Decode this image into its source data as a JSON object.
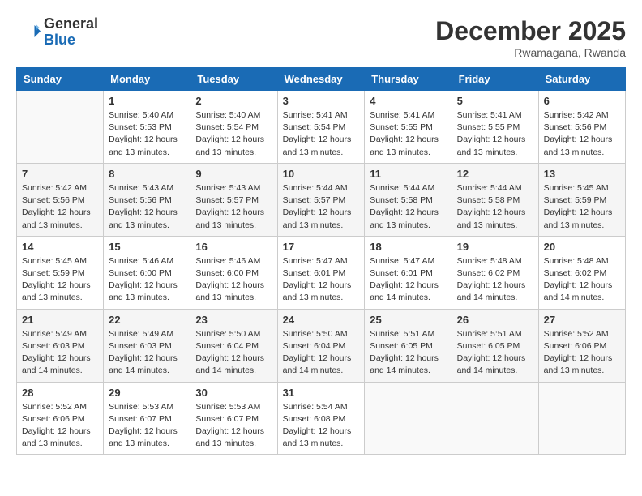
{
  "logo": {
    "general": "General",
    "blue": "Blue"
  },
  "header": {
    "month": "December 2025",
    "location": "Rwamagana, Rwanda"
  },
  "weekdays": [
    "Sunday",
    "Monday",
    "Tuesday",
    "Wednesday",
    "Thursday",
    "Friday",
    "Saturday"
  ],
  "weeks": [
    [
      {
        "day": "",
        "sunrise": "",
        "sunset": "",
        "daylight": ""
      },
      {
        "day": "1",
        "sunrise": "Sunrise: 5:40 AM",
        "sunset": "Sunset: 5:53 PM",
        "daylight": "Daylight: 12 hours and 13 minutes."
      },
      {
        "day": "2",
        "sunrise": "Sunrise: 5:40 AM",
        "sunset": "Sunset: 5:54 PM",
        "daylight": "Daylight: 12 hours and 13 minutes."
      },
      {
        "day": "3",
        "sunrise": "Sunrise: 5:41 AM",
        "sunset": "Sunset: 5:54 PM",
        "daylight": "Daylight: 12 hours and 13 minutes."
      },
      {
        "day": "4",
        "sunrise": "Sunrise: 5:41 AM",
        "sunset": "Sunset: 5:55 PM",
        "daylight": "Daylight: 12 hours and 13 minutes."
      },
      {
        "day": "5",
        "sunrise": "Sunrise: 5:41 AM",
        "sunset": "Sunset: 5:55 PM",
        "daylight": "Daylight: 12 hours and 13 minutes."
      },
      {
        "day": "6",
        "sunrise": "Sunrise: 5:42 AM",
        "sunset": "Sunset: 5:56 PM",
        "daylight": "Daylight: 12 hours and 13 minutes."
      }
    ],
    [
      {
        "day": "7",
        "sunrise": "Sunrise: 5:42 AM",
        "sunset": "Sunset: 5:56 PM",
        "daylight": "Daylight: 12 hours and 13 minutes."
      },
      {
        "day": "8",
        "sunrise": "Sunrise: 5:43 AM",
        "sunset": "Sunset: 5:56 PM",
        "daylight": "Daylight: 12 hours and 13 minutes."
      },
      {
        "day": "9",
        "sunrise": "Sunrise: 5:43 AM",
        "sunset": "Sunset: 5:57 PM",
        "daylight": "Daylight: 12 hours and 13 minutes."
      },
      {
        "day": "10",
        "sunrise": "Sunrise: 5:44 AM",
        "sunset": "Sunset: 5:57 PM",
        "daylight": "Daylight: 12 hours and 13 minutes."
      },
      {
        "day": "11",
        "sunrise": "Sunrise: 5:44 AM",
        "sunset": "Sunset: 5:58 PM",
        "daylight": "Daylight: 12 hours and 13 minutes."
      },
      {
        "day": "12",
        "sunrise": "Sunrise: 5:44 AM",
        "sunset": "Sunset: 5:58 PM",
        "daylight": "Daylight: 12 hours and 13 minutes."
      },
      {
        "day": "13",
        "sunrise": "Sunrise: 5:45 AM",
        "sunset": "Sunset: 5:59 PM",
        "daylight": "Daylight: 12 hours and 13 minutes."
      }
    ],
    [
      {
        "day": "14",
        "sunrise": "Sunrise: 5:45 AM",
        "sunset": "Sunset: 5:59 PM",
        "daylight": "Daylight: 12 hours and 13 minutes."
      },
      {
        "day": "15",
        "sunrise": "Sunrise: 5:46 AM",
        "sunset": "Sunset: 6:00 PM",
        "daylight": "Daylight: 12 hours and 13 minutes."
      },
      {
        "day": "16",
        "sunrise": "Sunrise: 5:46 AM",
        "sunset": "Sunset: 6:00 PM",
        "daylight": "Daylight: 12 hours and 13 minutes."
      },
      {
        "day": "17",
        "sunrise": "Sunrise: 5:47 AM",
        "sunset": "Sunset: 6:01 PM",
        "daylight": "Daylight: 12 hours and 13 minutes."
      },
      {
        "day": "18",
        "sunrise": "Sunrise: 5:47 AM",
        "sunset": "Sunset: 6:01 PM",
        "daylight": "Daylight: 12 hours and 14 minutes."
      },
      {
        "day": "19",
        "sunrise": "Sunrise: 5:48 AM",
        "sunset": "Sunset: 6:02 PM",
        "daylight": "Daylight: 12 hours and 14 minutes."
      },
      {
        "day": "20",
        "sunrise": "Sunrise: 5:48 AM",
        "sunset": "Sunset: 6:02 PM",
        "daylight": "Daylight: 12 hours and 14 minutes."
      }
    ],
    [
      {
        "day": "21",
        "sunrise": "Sunrise: 5:49 AM",
        "sunset": "Sunset: 6:03 PM",
        "daylight": "Daylight: 12 hours and 14 minutes."
      },
      {
        "day": "22",
        "sunrise": "Sunrise: 5:49 AM",
        "sunset": "Sunset: 6:03 PM",
        "daylight": "Daylight: 12 hours and 14 minutes."
      },
      {
        "day": "23",
        "sunrise": "Sunrise: 5:50 AM",
        "sunset": "Sunset: 6:04 PM",
        "daylight": "Daylight: 12 hours and 14 minutes."
      },
      {
        "day": "24",
        "sunrise": "Sunrise: 5:50 AM",
        "sunset": "Sunset: 6:04 PM",
        "daylight": "Daylight: 12 hours and 14 minutes."
      },
      {
        "day": "25",
        "sunrise": "Sunrise: 5:51 AM",
        "sunset": "Sunset: 6:05 PM",
        "daylight": "Daylight: 12 hours and 14 minutes."
      },
      {
        "day": "26",
        "sunrise": "Sunrise: 5:51 AM",
        "sunset": "Sunset: 6:05 PM",
        "daylight": "Daylight: 12 hours and 14 minutes."
      },
      {
        "day": "27",
        "sunrise": "Sunrise: 5:52 AM",
        "sunset": "Sunset: 6:06 PM",
        "daylight": "Daylight: 12 hours and 13 minutes."
      }
    ],
    [
      {
        "day": "28",
        "sunrise": "Sunrise: 5:52 AM",
        "sunset": "Sunset: 6:06 PM",
        "daylight": "Daylight: 12 hours and 13 minutes."
      },
      {
        "day": "29",
        "sunrise": "Sunrise: 5:53 AM",
        "sunset": "Sunset: 6:07 PM",
        "daylight": "Daylight: 12 hours and 13 minutes."
      },
      {
        "day": "30",
        "sunrise": "Sunrise: 5:53 AM",
        "sunset": "Sunset: 6:07 PM",
        "daylight": "Daylight: 12 hours and 13 minutes."
      },
      {
        "day": "31",
        "sunrise": "Sunrise: 5:54 AM",
        "sunset": "Sunset: 6:08 PM",
        "daylight": "Daylight: 12 hours and 13 minutes."
      },
      {
        "day": "",
        "sunrise": "",
        "sunset": "",
        "daylight": ""
      },
      {
        "day": "",
        "sunrise": "",
        "sunset": "",
        "daylight": ""
      },
      {
        "day": "",
        "sunrise": "",
        "sunset": "",
        "daylight": ""
      }
    ]
  ]
}
